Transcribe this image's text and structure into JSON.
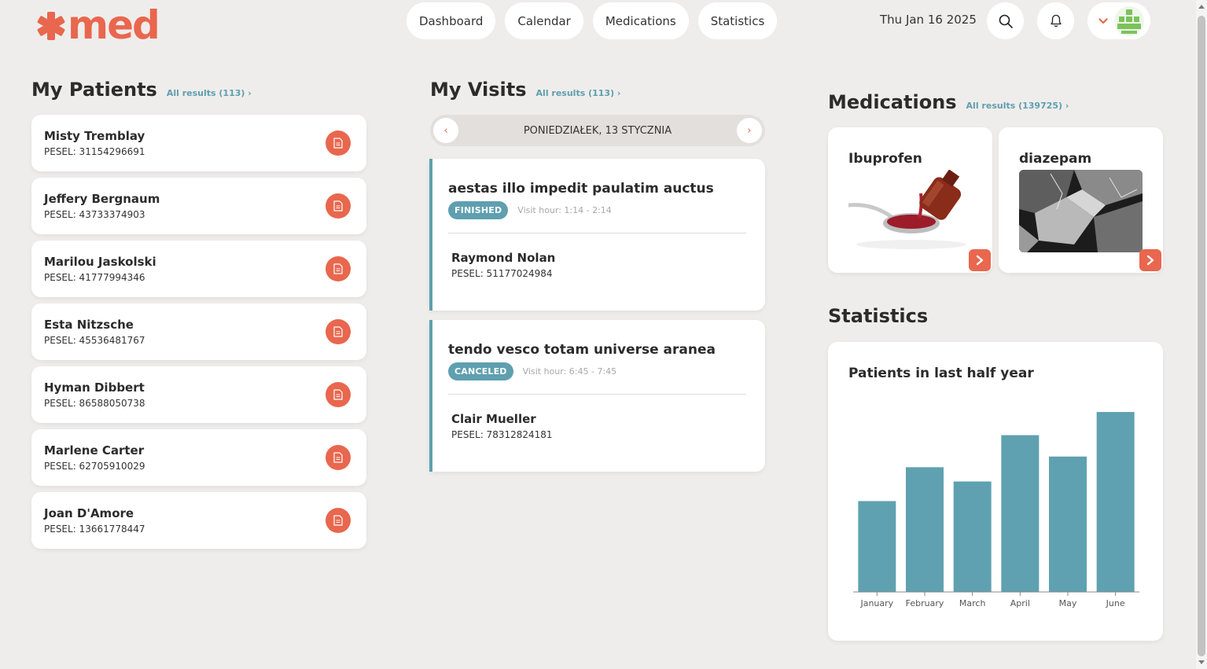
{
  "brand": {
    "logo_text": "med",
    "accent": "#e8674e"
  },
  "nav": {
    "items": [
      "Dashboard",
      "Calendar",
      "Medications",
      "Statistics"
    ]
  },
  "header": {
    "date": "Thu Jan 16 2025"
  },
  "icons": {
    "search": "search-icon",
    "bell": "bell-icon",
    "chevron": "chevron-down-icon",
    "avatar": "avatar"
  },
  "patients": {
    "title": "My Patients",
    "all_results": "All results (113) ›",
    "items": [
      {
        "name": "Misty Tremblay",
        "pesel": "PESEL: 31154296691"
      },
      {
        "name": "Jeffery Bergnaum",
        "pesel": "PESEL: 43733374903"
      },
      {
        "name": "Marilou Jaskolski",
        "pesel": "PESEL: 41777994346"
      },
      {
        "name": "Esta Nitzsche",
        "pesel": "PESEL: 45536481767"
      },
      {
        "name": "Hyman Dibbert",
        "pesel": "PESEL: 86588050738"
      },
      {
        "name": "Marlene Carter",
        "pesel": "PESEL: 62705910029"
      },
      {
        "name": "Joan D'Amore",
        "pesel": "PESEL: 13661778447"
      }
    ]
  },
  "visits": {
    "title": "My Visits",
    "all_results": "All results (113) ›",
    "day_label": "PONIEDZIAŁEK, 13 STYCZNIA",
    "prev": "‹",
    "next": "›",
    "items": [
      {
        "title": "aestas illo impedit paulatim auctus",
        "status": "FINISHED",
        "hour": "Visit hour: 1:14 - 2:14",
        "patient": "Raymond Nolan",
        "pesel": "PESEL: 51177024984"
      },
      {
        "title": "tendo vesco totam universe aranea",
        "status": "CANCELED",
        "hour": "Visit hour: 6:45 - 7:45",
        "patient": "Clair Mueller",
        "pesel": "PESEL: 78312824181"
      }
    ]
  },
  "medications": {
    "title": "Medications",
    "all_results": "All results (139725) ›",
    "items": [
      {
        "name": "Ibuprofen",
        "image": "syrup-spoon-image"
      },
      {
        "name": "diazepam",
        "image": "crystals-image"
      }
    ]
  },
  "statistics": {
    "title": "Statistics",
    "accent": "#5fa1b0"
  },
  "chart_data": {
    "type": "bar",
    "title": "Patients in last half year",
    "categories": [
      "January",
      "February",
      "March",
      "April",
      "May",
      "June"
    ],
    "values": [
      51,
      70,
      62,
      88,
      76,
      101
    ],
    "ylim": [
      0,
      105
    ],
    "grid": false,
    "legend": "none",
    "color": "#5fa1b0"
  }
}
